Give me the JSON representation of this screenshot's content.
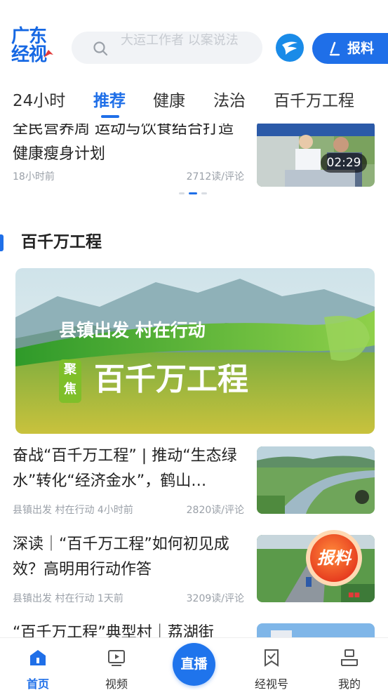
{
  "header": {
    "logo_line1": "广东",
    "logo_line2": "经视",
    "search_placeholder": "大运工作者 以案说法",
    "report_label": "报料"
  },
  "tabs": [
    {
      "label": "24小时",
      "active": false
    },
    {
      "label": "推荐",
      "active": true
    },
    {
      "label": "健康",
      "active": false
    },
    {
      "label": "法治",
      "active": false
    },
    {
      "label": "百千万工程",
      "active": false
    }
  ],
  "top_article": {
    "title": "全民营养周 运动与饮食结合打造健康瘦身计划",
    "time": "18小时前",
    "reads": "2712读/评论",
    "duration": "02:29"
  },
  "section": {
    "title": "百千万工程"
  },
  "banner": {
    "line1": "县镇出发 村在行动",
    "badge": "聚焦",
    "line2": "百千万工程"
  },
  "articles": [
    {
      "title": "奋战“百千万工程” | 推动“生态绿水”转化“经济金水”，鹤山…",
      "source": "县镇出发 村在行动",
      "time": "4小时前",
      "reads": "2820读/评论"
    },
    {
      "title": "深读｜“百千万工程”如何初见成效？高明用行动作答",
      "source": "县镇出发 村在行动",
      "time": "1天前",
      "reads": "3209读/评论"
    },
    {
      "title": "“百千万工程”典型村｜荔湖街",
      "source": "",
      "time": "",
      "reads": ""
    }
  ],
  "float_report_label": "报料",
  "bottom_nav": {
    "home": "首页",
    "video": "视频",
    "live": "直播",
    "jingshihao": "经视号",
    "mine": "我的"
  },
  "colors": {
    "accent": "#1f6fe8",
    "muted": "#9aa0a8"
  }
}
